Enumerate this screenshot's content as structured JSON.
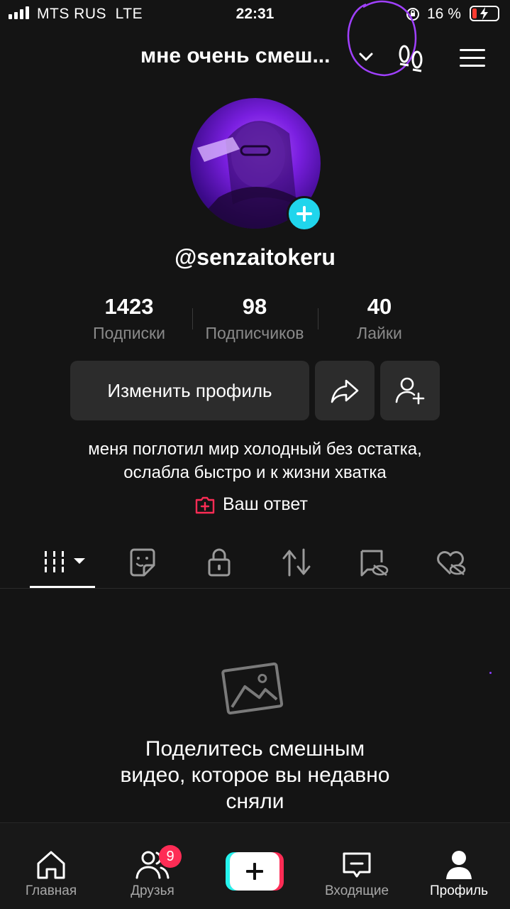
{
  "status_bar": {
    "carrier": "MTS RUS",
    "network": "LTE",
    "time": "22:31",
    "battery_percent": "16 %",
    "battery_color": "#ff3b30"
  },
  "header": {
    "account_name": "мне очень смеш...",
    "icons": [
      "chevron-down-icon",
      "footsteps-icon",
      "menu-icon"
    ]
  },
  "profile": {
    "username": "@senzaitokeru",
    "stats": [
      {
        "value": "1423",
        "label": "Подписки"
      },
      {
        "value": "98",
        "label": "Подписчиков"
      },
      {
        "value": "40",
        "label": "Лайки"
      }
    ],
    "edit_label": "Изменить профиль",
    "bio_lines": [
      "меня поглотил мир холодный без остатка,",
      "ослабла быстро и к жизни хватка"
    ],
    "answer_label": "Ваш ответ"
  },
  "tabs": [
    "videos-grid-icon",
    "sticker-icon",
    "lock-icon",
    "repost-icon",
    "hidden-tag-icon",
    "hidden-like-icon"
  ],
  "empty_state": {
    "lines": [
      "Поделитесь смешным",
      "видео, которое вы недавно",
      "сняли"
    ]
  },
  "bottom_nav": {
    "home": "Главная",
    "friends": "Друзья",
    "friends_badge": "9",
    "inbox": "Входящие",
    "profile": "Профиль"
  },
  "colors": {
    "background": "#141414",
    "accent_red": "#fe2c55",
    "accent_cyan": "#25f4ee",
    "annotation_purple": "#a040ff"
  }
}
